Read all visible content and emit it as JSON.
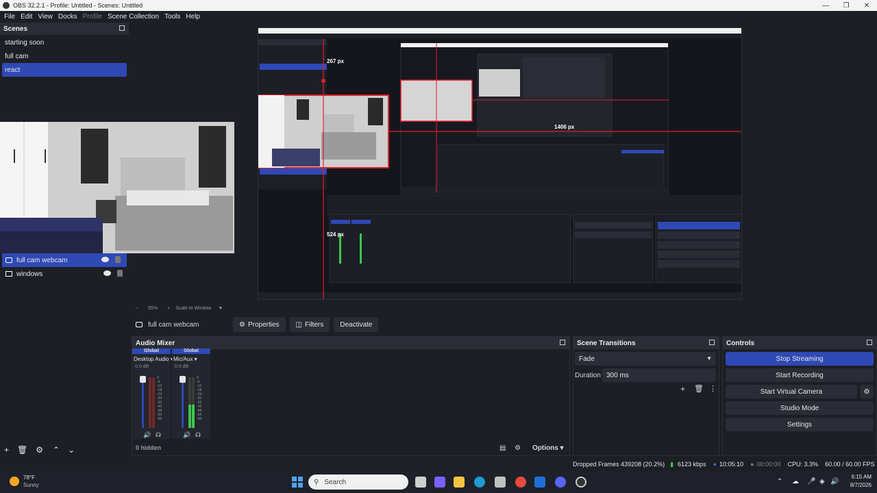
{
  "window": {
    "title": "OBS 32.2.1 - Profile: Untitled - Scenes: Untitled"
  },
  "menu": [
    "File",
    "Edit",
    "View",
    "Docks",
    "Profile",
    "Scene Collection",
    "Tools",
    "Help"
  ],
  "scenes": {
    "title": "Scenes",
    "items": [
      "starting soon",
      "full cam",
      "react"
    ],
    "selected": 2
  },
  "sources": {
    "items": [
      {
        "name": "full cam webcam",
        "type": "camera"
      },
      {
        "name": "windows",
        "type": "window"
      }
    ],
    "selected": 0
  },
  "preview": {
    "overlay_labels": [
      "267 px",
      "1406 px",
      "524 px"
    ],
    "zoom": "55%",
    "scale_mode": "Scale to Window"
  },
  "source_toolbar": {
    "source_name": "full cam webcam",
    "properties": "Properties",
    "filters": "Filters",
    "deactivate": "Deactivate"
  },
  "audio_mixer": {
    "title": "Audio Mixer",
    "channels": [
      {
        "badge": "Global",
        "name": "Desktop Audio",
        "db": "0.0 dB",
        "level": 0.0
      },
      {
        "badge": "Global",
        "name": "Mic/Aux",
        "db": "0.0 dB",
        "level": 0.45
      }
    ],
    "scale": [
      "0",
      "-6",
      "-12",
      "-18",
      "-24",
      "-30",
      "-36",
      "-42",
      "-48",
      "-54",
      "-60"
    ],
    "hidden_label": "0 hidden",
    "options_label": "Options"
  },
  "scene_transitions": {
    "title": "Scene Transitions",
    "transition": "Fade",
    "duration_label": "Duration",
    "duration_value": "300 ms"
  },
  "controls": {
    "title": "Controls",
    "buttons": [
      "Stop Streaming",
      "Start Recording",
      "Start Virtual Camera",
      "Studio Mode",
      "Settings"
    ]
  },
  "statusbar": {
    "dropped_frames": "Dropped Frames 439208 (20.2%)",
    "bitrate": "6123 kbps",
    "stream_time": "10:05:10",
    "record_time": "00:00:00",
    "cpu": "CPU: 3.3%",
    "fps": "60.00 / 60.00 FPS"
  },
  "taskbar": {
    "weather_temp": "78°F",
    "weather_desc": "Sunny",
    "search_placeholder": "Search",
    "time": "6:15 AM",
    "date": "8/7/2026"
  },
  "colors": {
    "accent": "#2f49b5",
    "red_guides": "#e0202a",
    "meter_green": "#3fc74a",
    "meter_yellow": "#c7c23f"
  }
}
